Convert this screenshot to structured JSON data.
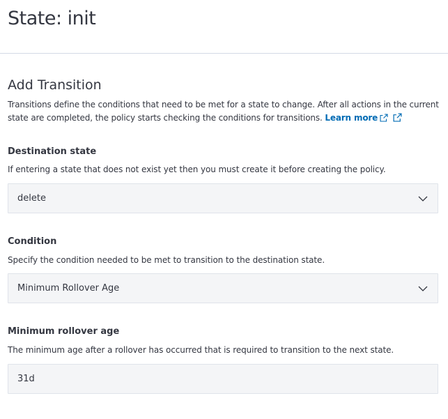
{
  "header": {
    "title": "State: init"
  },
  "transition": {
    "title": "Add Transition",
    "description": "Transitions define the conditions that need to be met for a state to change. After all actions in the current state are completed, the policy starts checking the conditions for transitions.",
    "learn_more": "Learn more"
  },
  "destination": {
    "label": "Destination state",
    "help": "If entering a state that does not exist yet then you must create it before creating the policy.",
    "value": "delete"
  },
  "condition": {
    "label": "Condition",
    "help": "Specify the condition needed to be met to transition to the destination state.",
    "value": "Minimum Rollover Age"
  },
  "rollover_age": {
    "label": "Minimum rollover age",
    "help": "The minimum age after a rollover has occurred that is required to transition to the next state.",
    "value": "31d"
  },
  "colors": {
    "text": "#343741",
    "link": "#006bb4",
    "control_bg": "#f4f5f7",
    "divider": "#d3dae6"
  },
  "icons": {
    "external_link": "external-link-icon",
    "select_arrow": "chevron-down-icon"
  }
}
